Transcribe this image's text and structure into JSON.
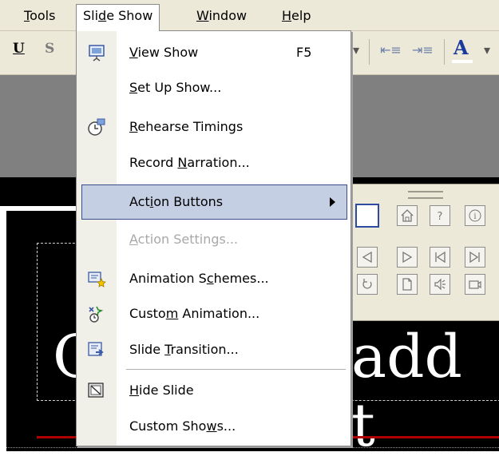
{
  "menubar": {
    "items": [
      {
        "pre": "",
        "ul": "T",
        "post": "ools"
      },
      {
        "pre": "Sli",
        "ul": "d",
        "post": "e Show"
      },
      {
        "pre": "",
        "ul": "W",
        "post": "indow"
      },
      {
        "pre": "",
        "ul": "H",
        "post": "elp"
      }
    ]
  },
  "toolbar": {
    "underline": "U",
    "shadow": "S",
    "font_color": "A"
  },
  "menu": {
    "items": [
      {
        "pre": "",
        "ul": "V",
        "post": "iew Show",
        "shortcut": "F5",
        "icon": "view-show-icon"
      },
      {
        "pre": "",
        "ul": "S",
        "post": "et Up Show...",
        "icon": ""
      },
      {
        "pre": "",
        "ul": "R",
        "post": "ehearse Timings",
        "icon": "rehearse-timings-icon"
      },
      {
        "pre": "Record ",
        "ul": "N",
        "post": "arration...",
        "icon": ""
      },
      {
        "pre": "Act",
        "ul": "i",
        "post": "on Buttons",
        "icon": ""
      },
      {
        "pre": "",
        "ul": "A",
        "post": "ction Settings...",
        "icon": ""
      },
      {
        "pre": "Animation S",
        "ul": "c",
        "post": "hemes...",
        "icon": "animation-schemes-icon"
      },
      {
        "pre": "Custo",
        "ul": "m",
        "post": " Animation...",
        "icon": "custom-animation-icon"
      },
      {
        "pre": "Slide ",
        "ul": "T",
        "post": "ransition...",
        "icon": "slide-transition-icon"
      },
      {
        "pre": "",
        "ul": "H",
        "post": "ide Slide",
        "icon": "hide-slide-icon"
      },
      {
        "pre": "Custom Sho",
        "ul": "w",
        "post": "s...",
        "icon": ""
      }
    ]
  },
  "slide": {
    "title_left": "C",
    "title_right": "add t"
  },
  "colors": {
    "menu_highlight": "#c5cfe4",
    "highlight_border": "#3a4f8a",
    "disabled_text": "#a8a8a8"
  }
}
